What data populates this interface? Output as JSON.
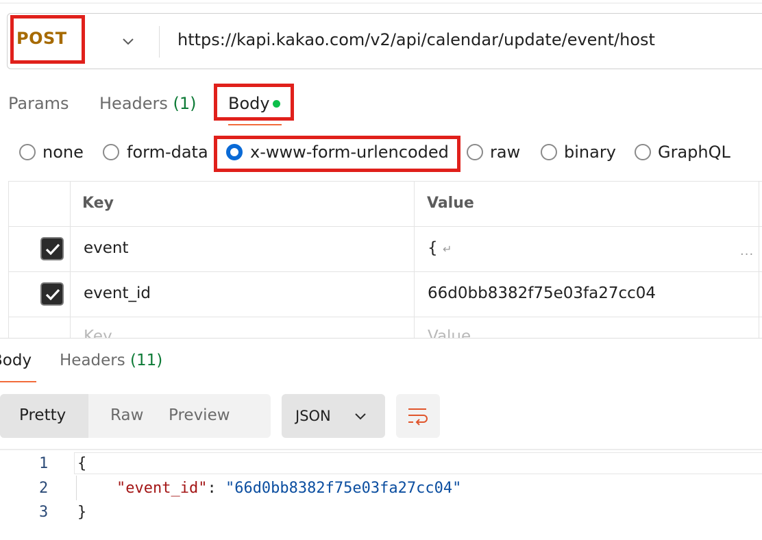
{
  "request": {
    "method": "POST",
    "url": "https://kapi.kakao.com/v2/api/calendar/update/event/host"
  },
  "request_tabs": {
    "params": "Params",
    "headers": "Headers",
    "headers_count": "(1)",
    "body": "Body"
  },
  "body_types": [
    "none",
    "form-data",
    "x-www-form-urlencoded",
    "raw",
    "binary",
    "GraphQL"
  ],
  "body_type_selected": "x-www-form-urlencoded",
  "table": {
    "headers": {
      "key": "Key",
      "value": "Value"
    },
    "rows": [
      {
        "checked": true,
        "key": "event",
        "value": "{",
        "value_newline": "↵",
        "more": "..."
      },
      {
        "checked": true,
        "key": "event_id",
        "value": "66d0bb8382f75e03fa27cc04"
      }
    ],
    "placeholder": {
      "key": "Key",
      "value": "Value"
    }
  },
  "response_tabs": {
    "body": "Body",
    "headers": "Headers",
    "headers_count": "(11)"
  },
  "view_modes": [
    "Pretty",
    "Raw",
    "Preview"
  ],
  "format": "JSON",
  "code": {
    "line_numbers": [
      "1",
      "2",
      "3"
    ],
    "open_brace": "{",
    "key": "\"event_id\"",
    "colon": ": ",
    "value": "\"66d0bb8382f75e03fa27cc04\"",
    "close_brace": "}"
  },
  "colors": {
    "highlight_box": "#e0201b",
    "method_post": "#a66a00",
    "active_tab_underline": "#f26b3a",
    "status_dot": "#0cbf4a",
    "radio_selected": "#0a6ad6"
  }
}
